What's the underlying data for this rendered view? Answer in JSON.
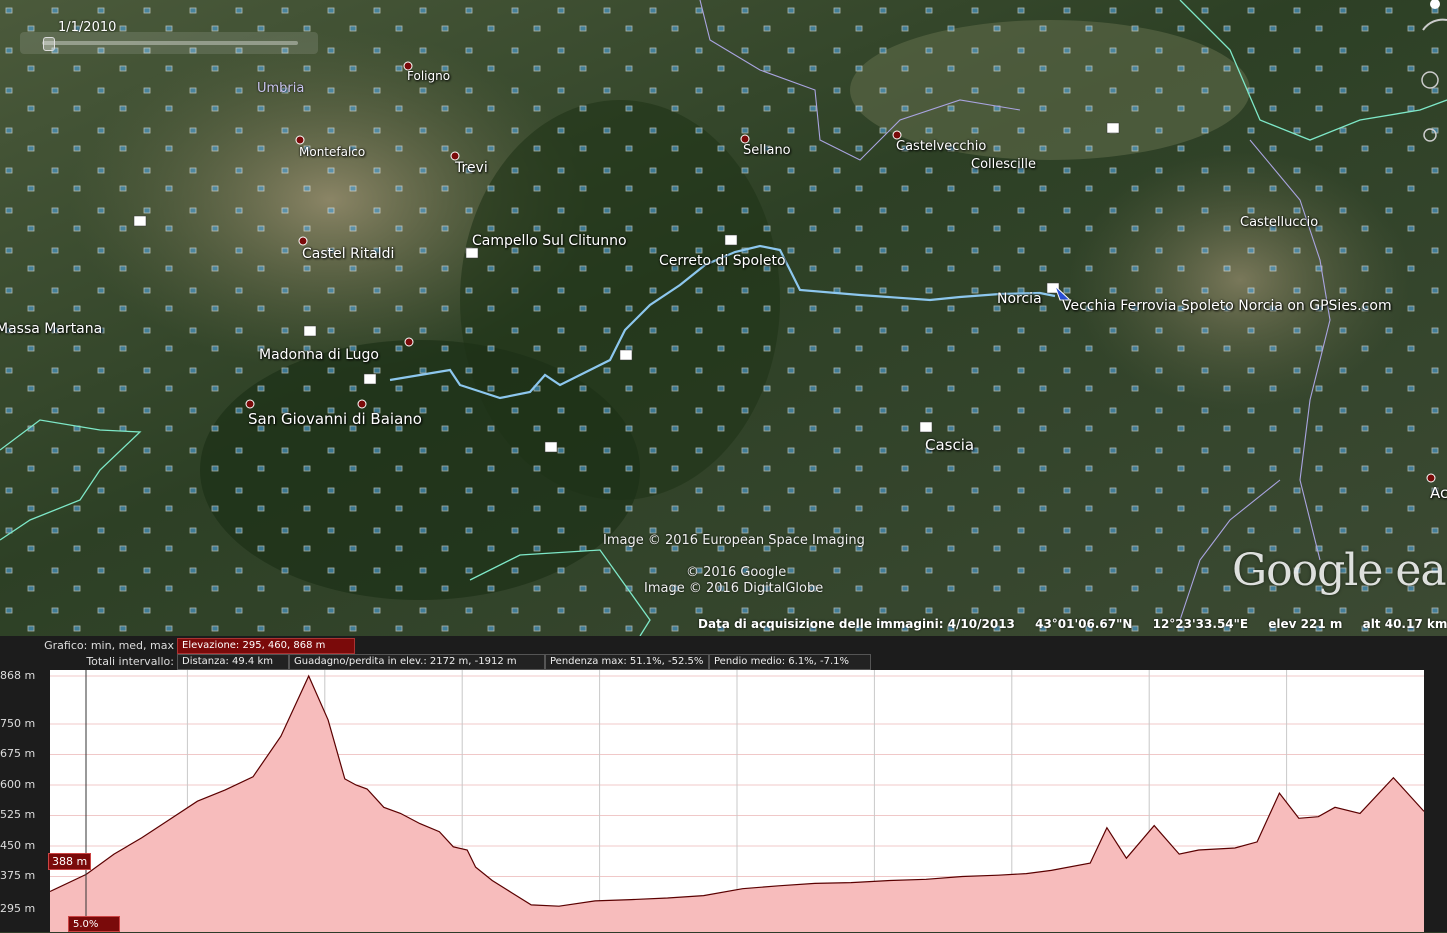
{
  "map": {
    "time_slider_date": "1/1/2010",
    "region_label": "Umbria",
    "places": [
      {
        "name": "Foligno"
      },
      {
        "name": "Montefalco"
      },
      {
        "name": "Trevi"
      },
      {
        "name": "Sellano"
      },
      {
        "name": "Castelvecchio"
      },
      {
        "name": "Collescille"
      },
      {
        "name": "Castelluccio"
      },
      {
        "name": "Castel Ritaldi"
      },
      {
        "name": "Campello Sul Clitunno"
      },
      {
        "name": "Cerreto di Spoleto"
      },
      {
        "name": "Norcia"
      },
      {
        "name": "Vecchia Ferrovia Spoleto Norcia on GPSies.com"
      },
      {
        "name": "Massa Martana"
      },
      {
        "name": "Madonna di Lugo"
      },
      {
        "name": "San Giovanni di Baiano"
      },
      {
        "name": "Cascia"
      },
      {
        "name": "Ac"
      }
    ],
    "copyrights": {
      "line1": "Image © 2016 European Space Imaging",
      "line2": "© 2016 Google",
      "line3": "Image © 2016 DigitalGlobe"
    },
    "logo": "Google earth",
    "status": {
      "acquisition": "Data di acquisizione delle immagini: 4/10/2013",
      "lat": "43°01'06.67\"N",
      "lon": "12°23'33.54\"E",
      "elev": "elev   221 m",
      "alt": "alt  40.17 km"
    }
  },
  "profile": {
    "row1_label": "Grafico: min, med, max",
    "elevation_box": "Elevazione: 295, 460, 868 m",
    "row2_label": "Totali intervallo:",
    "distance_box": "Distanza: 49.4 km",
    "gain_box": "Guadagno/perdita in elev.: 2172 m, -1912 m",
    "slope_max_box": "Pendenza max: 51.1%, -52.5%",
    "slope_avg_box": "Pendio medio: 6.1%, -7.1%",
    "cursor_value": "388 m",
    "cursor_grade": "5.0%",
    "colors": {
      "fill": "#f7bcbc",
      "line": "#5a0000",
      "panel": "#1c1c1c",
      "accent": "#7a0a0a"
    }
  },
  "chart_data": {
    "type": "area",
    "xlabel": "",
    "ylabel": "",
    "x_unit": "km",
    "y_unit": "m",
    "ylim": [
      295,
      868
    ],
    "y_ticks": [
      "868 m",
      "750 m",
      "675 m",
      "600 m",
      "525 m",
      "450 m",
      "375 m",
      "295 m"
    ],
    "y_tick_values": [
      868,
      750,
      675,
      600,
      525,
      450,
      375,
      295
    ],
    "x": [
      0,
      1.3,
      2.3,
      3.3,
      4.3,
      5.3,
      6.3,
      7.3,
      8.3,
      9.3,
      10.0,
      10.6,
      11.0,
      11.4,
      12.0,
      12.6,
      13.3,
      14.0,
      14.5,
      15.0,
      15.3,
      15.9,
      16.6,
      17.3,
      18.3,
      19.6,
      20.9,
      22.2,
      23.5,
      24.9,
      26.2,
      27.5,
      28.8,
      30.2,
      31.5,
      32.8,
      34.1,
      35.1,
      36.0,
      37.4,
      38.0,
      38.7,
      39.7,
      40.6,
      41.3,
      42.6,
      43.4,
      44.2,
      44.9,
      45.6,
      46.2,
      47.1,
      48.3,
      49.4
    ],
    "y": [
      338,
      380,
      430,
      470,
      515,
      560,
      588,
      620,
      720,
      868,
      760,
      615,
      600,
      590,
      545,
      530,
      505,
      485,
      448,
      440,
      398,
      365,
      335,
      305,
      302,
      315,
      318,
      322,
      328,
      345,
      352,
      358,
      360,
      365,
      368,
      375,
      378,
      382,
      390,
      408,
      495,
      420,
      500,
      430,
      440,
      445,
      460,
      580,
      518,
      522,
      545,
      530,
      618,
      535
    ]
  }
}
